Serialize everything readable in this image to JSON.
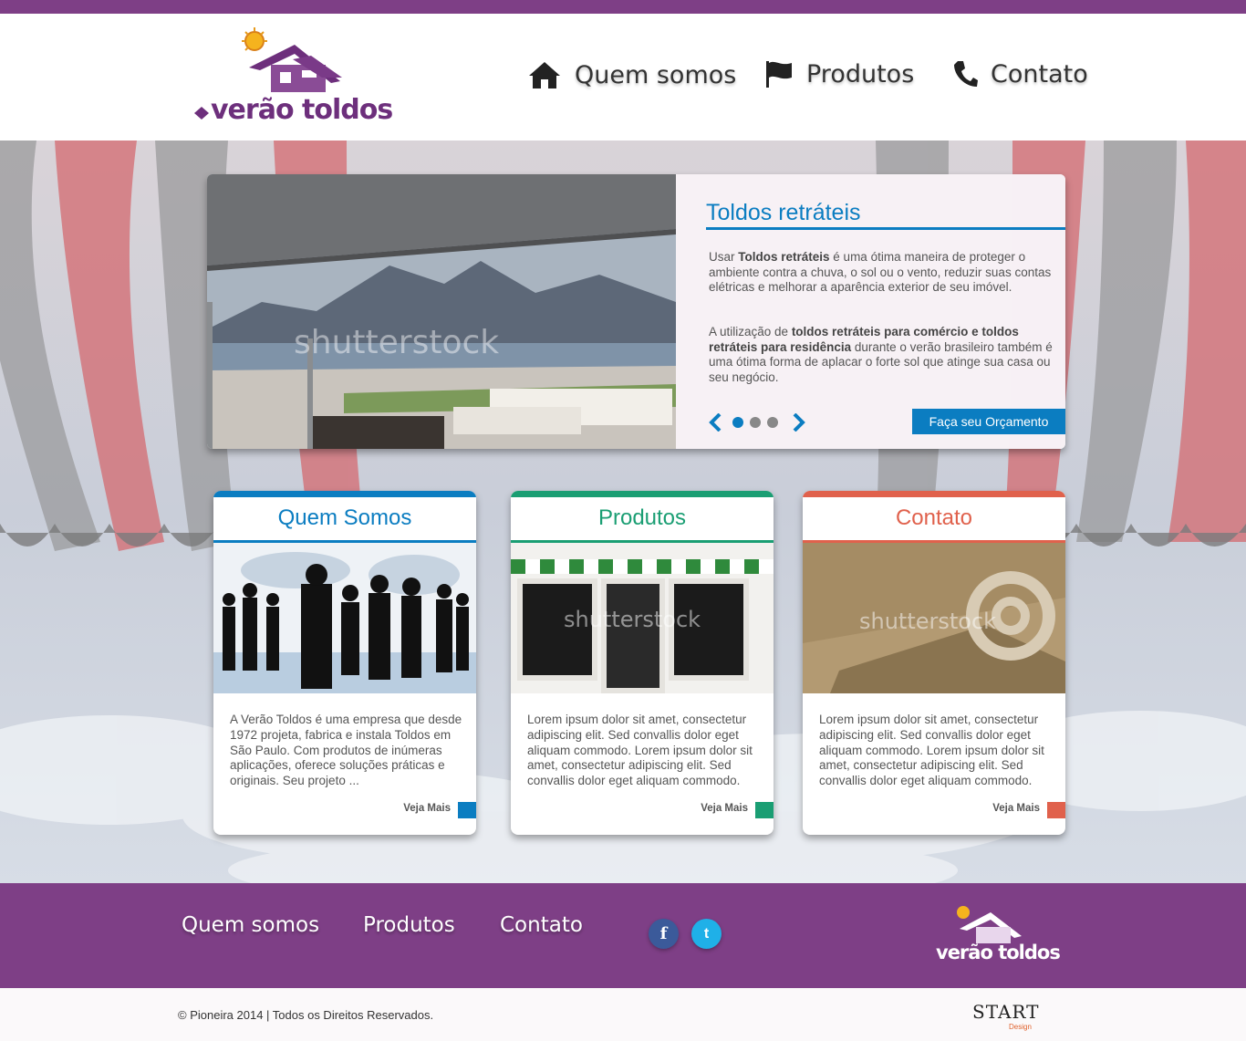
{
  "brand": {
    "name": "verão toldos"
  },
  "colors": {
    "purple": "#7e3f86",
    "blue": "#0b7dc1",
    "green": "#1a9e73",
    "red": "#e0614c"
  },
  "nav": [
    {
      "label": "Quem somos",
      "icon": "home-icon"
    },
    {
      "label": "Produtos",
      "icon": "flag-icon"
    },
    {
      "label": "Contato",
      "icon": "phone-icon"
    }
  ],
  "slider": {
    "title": "Toldos retráteis",
    "p1_pre": "Usar ",
    "p1_bold": "Toldos retráteis",
    "p1_post": " é uma ótima maneira de proteger o ambiente contra a chuva, o sol ou o vento, reduzir suas contas elétricas e melhorar a aparência exterior de seu imóvel.",
    "p2_pre": "A utilização de ",
    "p2_bold": "toldos retráteis para comércio e toldos retráteis para residência",
    "p2_post": " durante o verão brasileiro também é uma ótima forma de aplacar o forte sol que atinge sua casa ou seu negócio.",
    "watermark": "shutterstock",
    "cta": "Faça seu Orçamento",
    "slide_count": 3,
    "active_slide": 1
  },
  "cards": [
    {
      "title": "Quem Somos",
      "color": "#0b7dc1",
      "text": "A Verão Toldos é uma empresa que desde 1972 projeta, fabrica e instala Toldos em São Paulo. Com produtos de inúmeras aplicações, oferece soluções práticas e originais. Seu projeto ...",
      "more": "Veja Mais"
    },
    {
      "title": "Produtos",
      "color": "#1a9e73",
      "text": "Lorem ipsum dolor sit amet, consectetur adipiscing elit. Sed convallis dolor eget aliquam commodo. Lorem ipsum dolor sit amet, consectetur adipiscing elit. Sed convallis dolor eget aliquam commodo.",
      "more": "Veja Mais",
      "watermark": "shutterstock"
    },
    {
      "title": "Contato",
      "color": "#e0614c",
      "text": "Lorem ipsum dolor sit amet, consectetur adipiscing elit. Sed convallis dolor eget aliquam commodo. Lorem ipsum dolor sit amet, consectetur adipiscing elit. Sed convallis dolor eget aliquam commodo.",
      "more": "Veja Mais",
      "watermark": "shutterstock"
    }
  ],
  "footer": {
    "links": [
      "Quem somos",
      "Produtos",
      "Contato"
    ],
    "social": [
      {
        "glyph": "f",
        "icon": "facebook-icon"
      },
      {
        "glyph": "t",
        "icon": "twitter-icon"
      }
    ],
    "copyright": "© Pioneira 2014 | Todos os Direitos Reservados.",
    "credit_main": "START",
    "credit_sub": "Design"
  }
}
